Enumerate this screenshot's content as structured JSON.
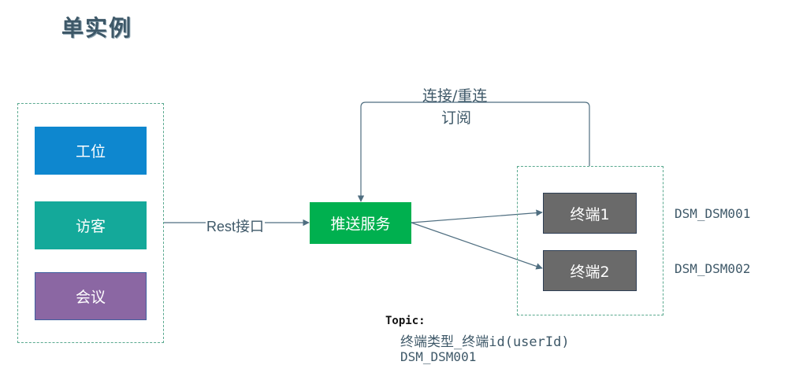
{
  "title": "单实例",
  "clients": {
    "workstation": "工位",
    "visitor": "访客",
    "meeting": "会议"
  },
  "push_service": "推送服务",
  "rest_label": "Rest接口",
  "connect_label": "连接/重连",
  "subscribe_label": "订阅",
  "terminals": {
    "t1": {
      "label": "终端1",
      "id": "DSM_DSM001"
    },
    "t2": {
      "label": "终端2",
      "id": "DSM_DSM002"
    }
  },
  "topic": {
    "heading": "Topic:",
    "format": "终端类型_终端id(userId)",
    "example": "DSM_DSM001"
  },
  "colors": {
    "workstation": "#0e87cf",
    "visitor": "#14a99a",
    "meeting": "#8b67a3",
    "push_service": "#00b04f",
    "terminal": "#6a6a6a",
    "line": "#4f6e80"
  }
}
